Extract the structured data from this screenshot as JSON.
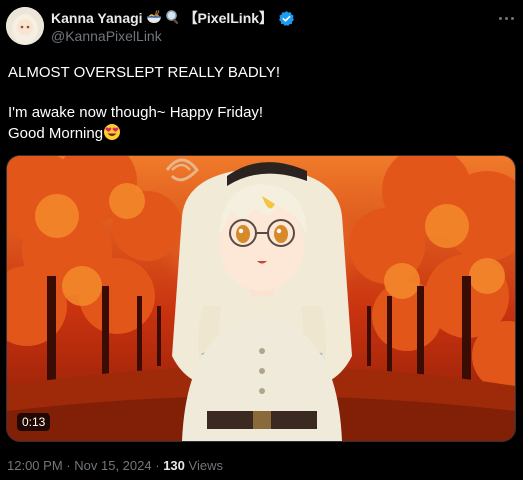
{
  "author": {
    "display_name": "Kanna Yanagi",
    "name_suffix": "【PixelLink】",
    "handle": "@KannaPixelLink",
    "verified": true,
    "accent_color": "#1d9bf0"
  },
  "icons": {
    "bowl": "noodle-bowl-emoji",
    "magnifier": "magnifying-glass-emoji",
    "verified": "verified-badge-icon",
    "more": "more-horizontal-icon",
    "face": "heart-eyes-emoji"
  },
  "tweet": {
    "line1": "ALMOST OVERSLEPT REALLY BADLY!",
    "line2": "I'm awake now though~ Happy Friday!",
    "line3": "Good Morning"
  },
  "media": {
    "duration": "0:13"
  },
  "meta": {
    "time": "12:00 PM",
    "separator": "·",
    "date": "Nov 15, 2024",
    "views_count": "130",
    "views_label": "Views"
  }
}
